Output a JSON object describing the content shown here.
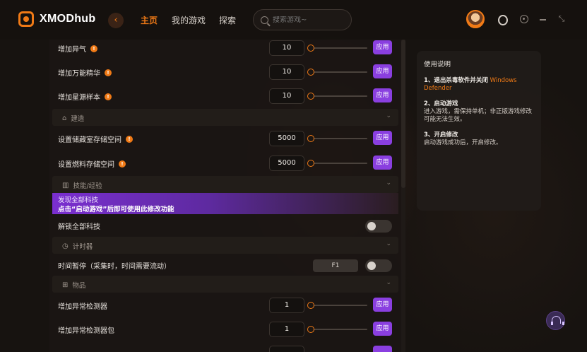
{
  "app": {
    "logo": "XMODhub"
  },
  "nav": {
    "home": "主页",
    "my_games": "我的游戏",
    "explore": "探索"
  },
  "search": {
    "placeholder": "搜索游戏~"
  },
  "colors": {
    "accent": "#f07a16",
    "apply": "#8a3fe0"
  },
  "rows_top": [
    {
      "label": "增加异气",
      "value": "10",
      "apply": "应用"
    },
    {
      "label": "增加万能精华",
      "value": "10",
      "apply": "应用"
    },
    {
      "label": "增加星源样本",
      "value": "10",
      "apply": "应用"
    }
  ],
  "section_build": {
    "label": "建造",
    "icon": "bank-icon"
  },
  "rows_build": [
    {
      "label": "设置储藏室存储空间",
      "value": "5000",
      "apply": "应用"
    },
    {
      "label": "设置燃料存储空间",
      "value": "5000",
      "apply": "应用"
    }
  ],
  "section_skills": {
    "label": "技能/经验",
    "icon": "bars-icon"
  },
  "banner": {
    "line1": "发现全部科技",
    "line2": "点击“启动游戏”后即可使用此修改功能"
  },
  "unlock_tech": {
    "label": "解锁全部科技"
  },
  "section_timer": {
    "label": "计时器",
    "icon": "clock-icon"
  },
  "time_pause": {
    "label": "时间暂停（采集时，时间需要流动）",
    "hotkey": "F1"
  },
  "section_items": {
    "label": "物品",
    "icon": "box-icon"
  },
  "rows_items": [
    {
      "label": "增加异常检测器",
      "value": "1",
      "apply": "应用"
    },
    {
      "label": "增加异常检测器包",
      "value": "1",
      "apply": "应用"
    }
  ],
  "instructions": {
    "title": "使用说明",
    "step1_head": "1、退出杀毒软件并关闭",
    "step1_highlight": "Windows Defender",
    "step2_head": "2、启动游戏",
    "step2_body": "进入游戏，需保持单机；非正版游戏修改可能无法生效。",
    "step3_head": "3、开启修改",
    "step3_body": "启动游戏成功后，开启修改。"
  }
}
